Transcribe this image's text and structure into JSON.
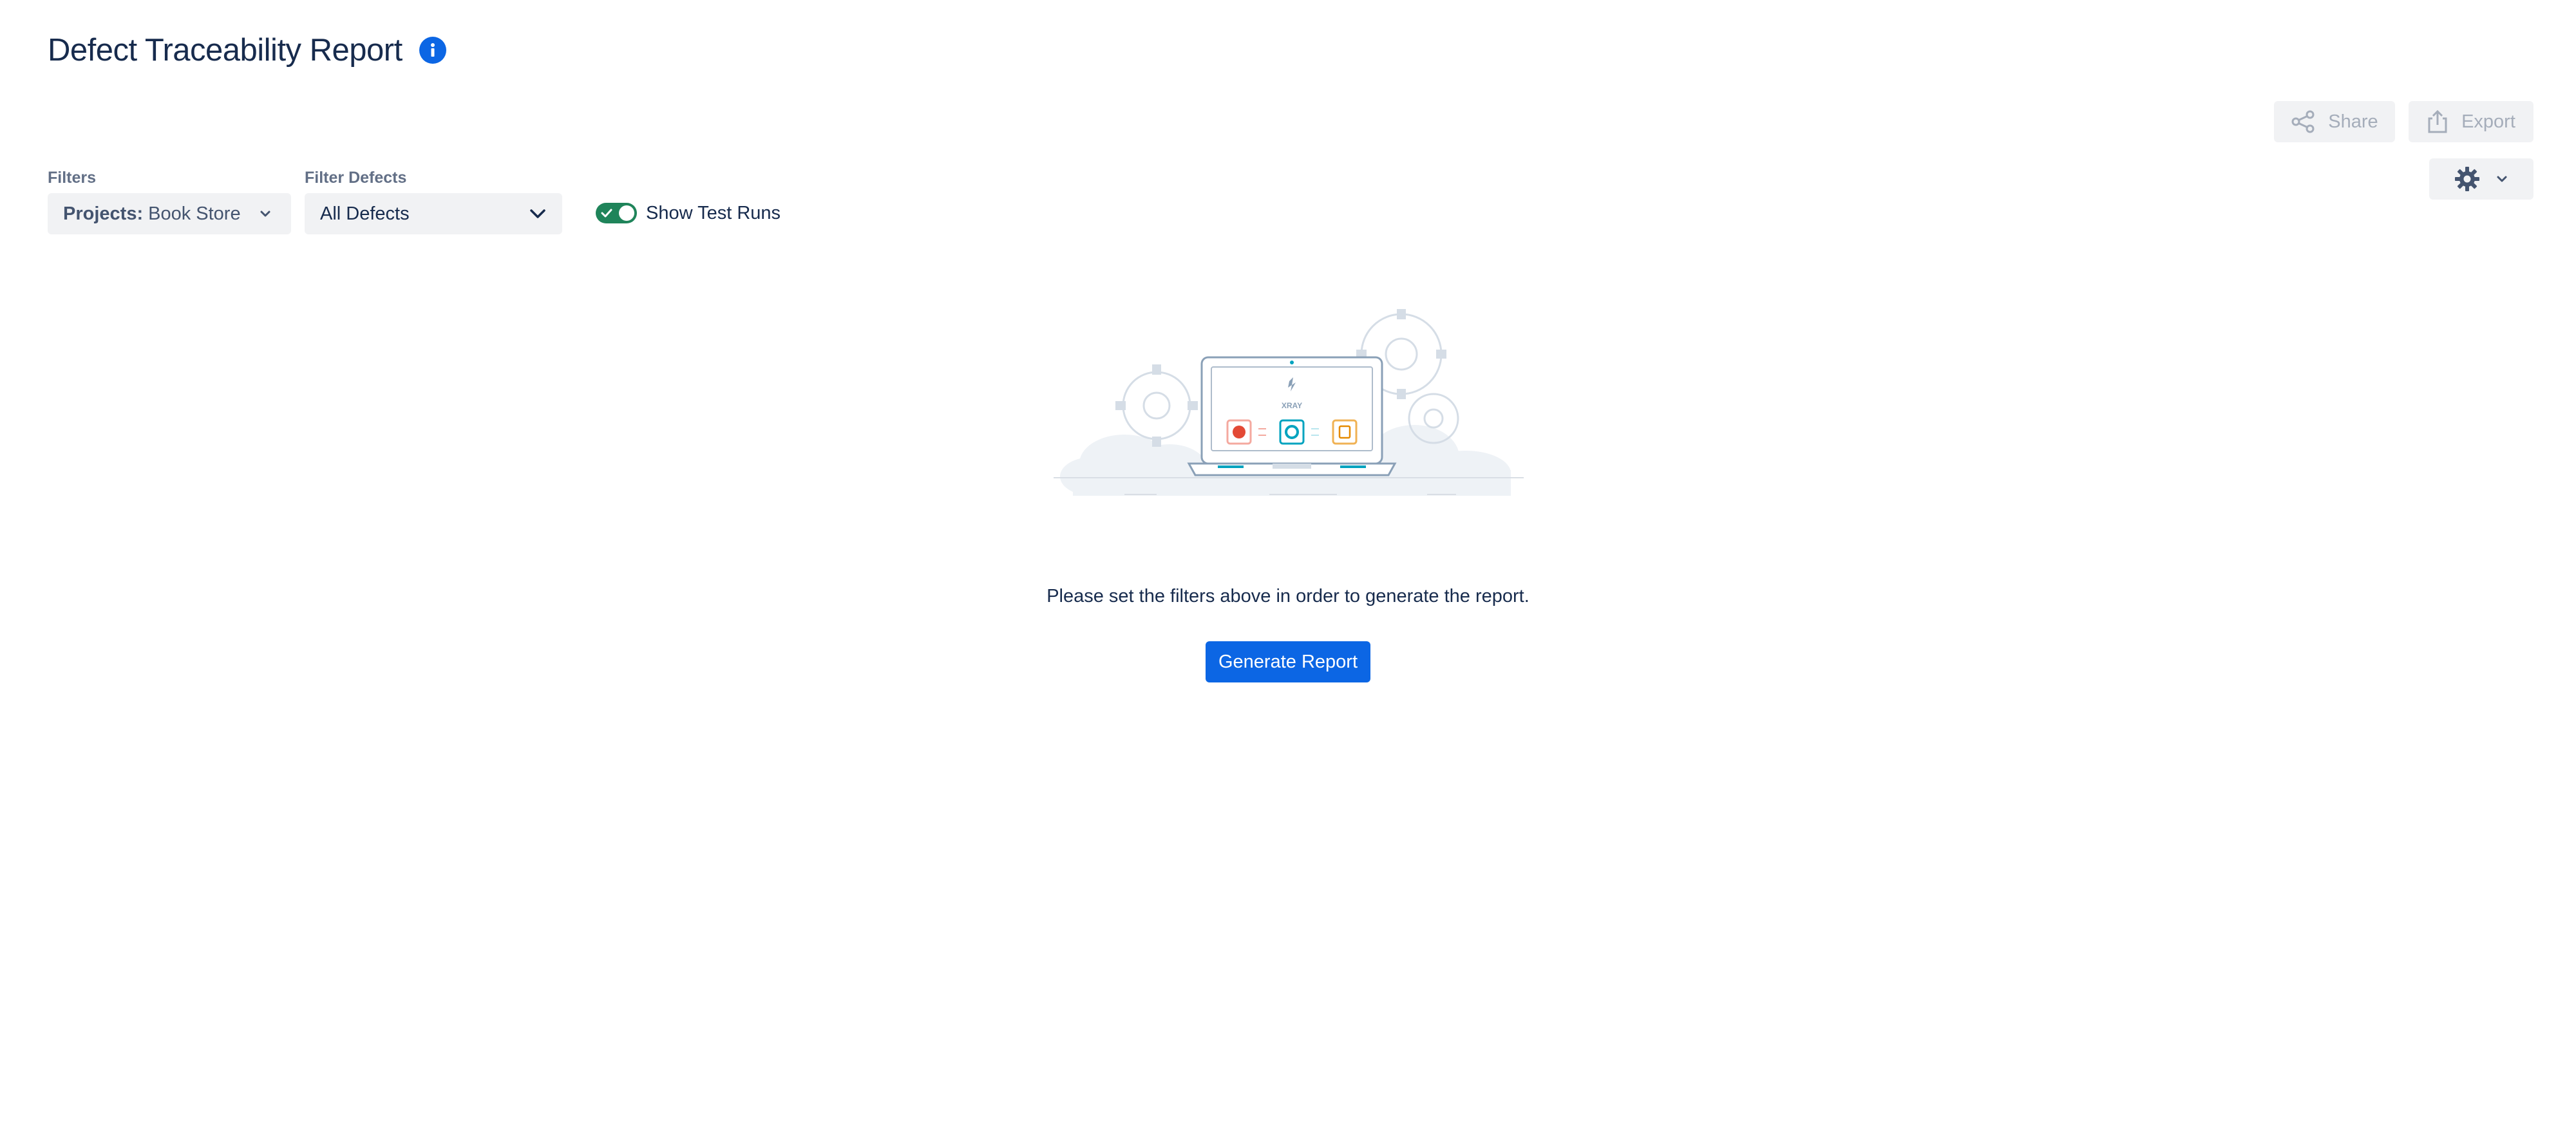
{
  "header": {
    "title": "Defect Traceability Report",
    "info_icon": "info-icon"
  },
  "actions": {
    "share_label": "Share",
    "export_label": "Export",
    "share_icon": "share-icon",
    "export_icon": "export-icon",
    "settings_icon": "gear-icon"
  },
  "filters": {
    "filters_label": "Filters",
    "projects_key": "Projects:",
    "projects_value": "Book Store",
    "filter_defects_label": "Filter Defects",
    "filter_defects_value": "All Defects",
    "show_test_runs_label": "Show Test Runs",
    "show_test_runs_on": true
  },
  "empty_state": {
    "illustration_caption": "XRAY",
    "message": "Please set the filters above in order to generate the report.",
    "button_label": "Generate Report"
  },
  "colors": {
    "primary": "#0c66e4",
    "toggle_on": "#1f845a",
    "title": "#172b4d",
    "disabled_text": "#a5adba",
    "button_bg": "#f1f2f4"
  }
}
